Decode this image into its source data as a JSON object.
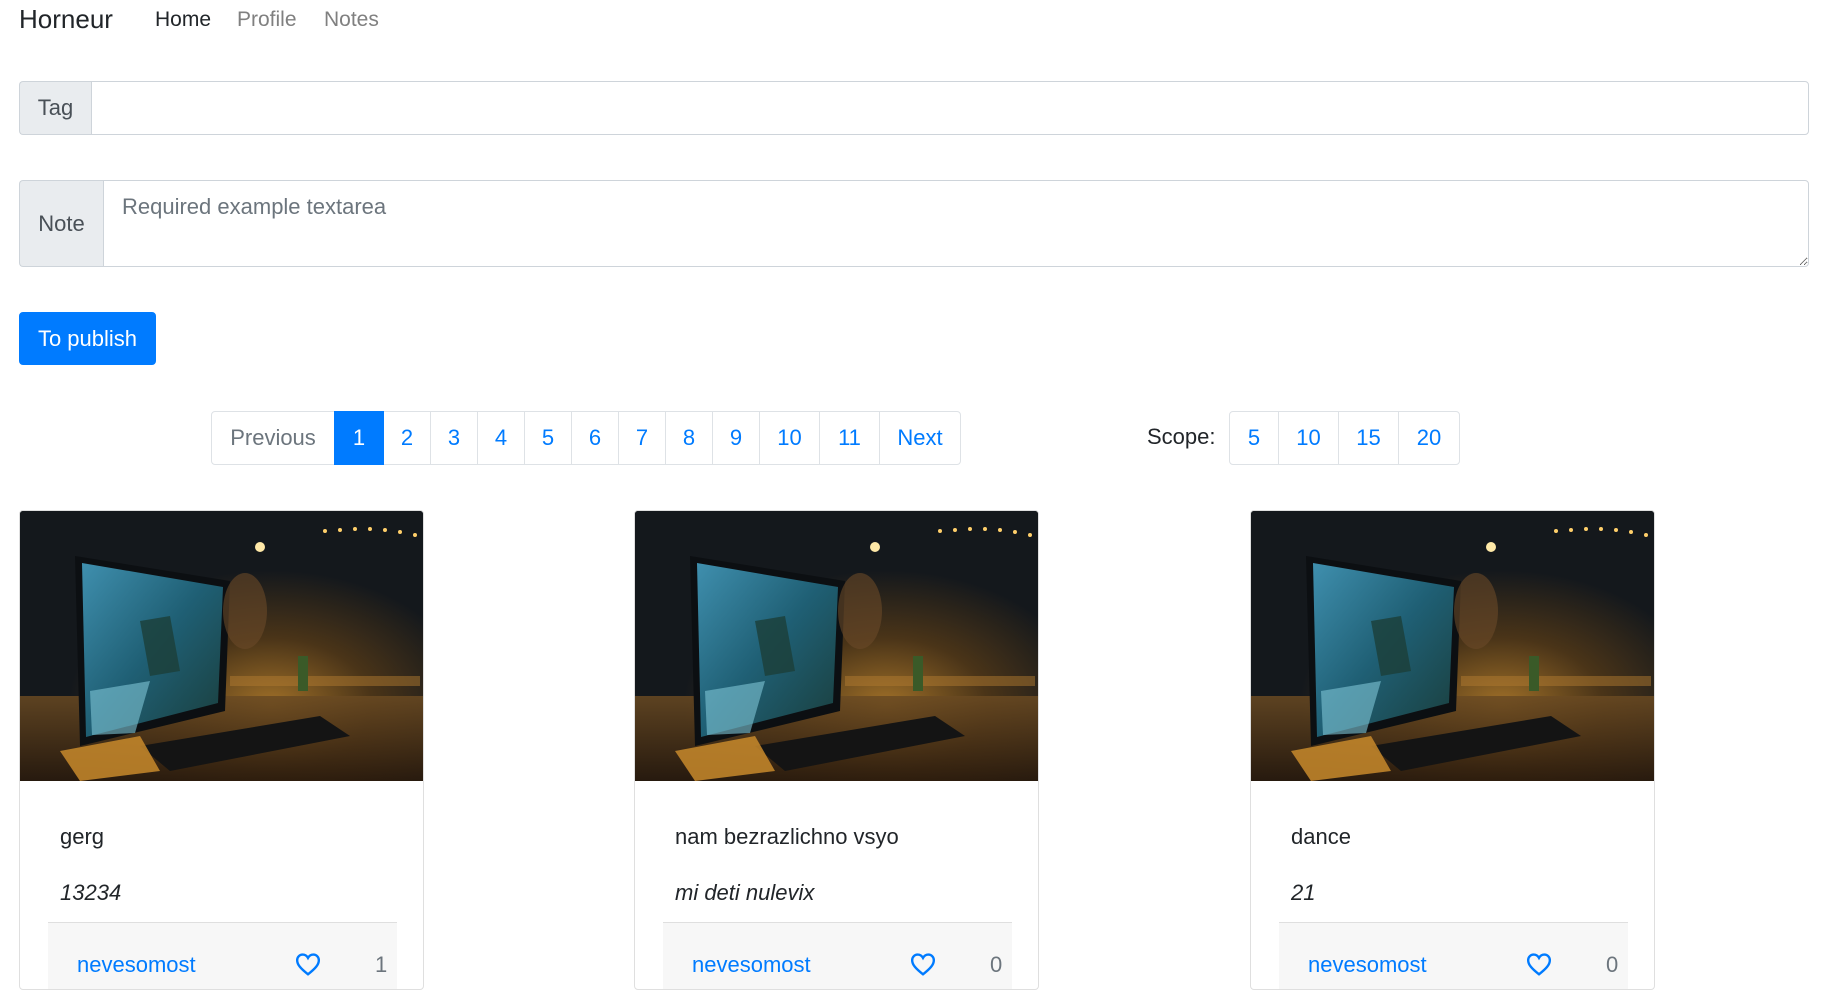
{
  "navbar": {
    "brand": "Horneur",
    "links": [
      {
        "label": "Home"
      },
      {
        "label": "Profile"
      },
      {
        "label": "Notes"
      }
    ]
  },
  "form": {
    "tag_label": "Tag",
    "tag_value": "",
    "note_label": "Note",
    "note_placeholder": "Required example textarea",
    "publish_label": "To publish"
  },
  "pagination": {
    "previous": "Previous",
    "pages": [
      "1",
      "2",
      "3",
      "4",
      "5",
      "6",
      "7",
      "8",
      "9",
      "10",
      "11"
    ],
    "active_page": "1",
    "next": "Next"
  },
  "scope": {
    "label": "Scope:",
    "options": [
      "5",
      "10",
      "15",
      "20"
    ]
  },
  "cards": [
    {
      "title": "gerg",
      "text": "13234",
      "author": "nevesomost",
      "likes": "1"
    },
    {
      "title": "nam bezrazlichno vsyo",
      "text": "mi deti nulevix",
      "author": "nevesomost",
      "likes": "0"
    },
    {
      "title": "dance",
      "text": "21",
      "author": "nevesomost",
      "likes": "0"
    }
  ],
  "colors": {
    "primary": "#007bff",
    "text": "#212529",
    "muted": "#6c757d"
  },
  "icons": {
    "like": "heart-outline-icon",
    "card_image": "dark-desk-computer-photo"
  }
}
